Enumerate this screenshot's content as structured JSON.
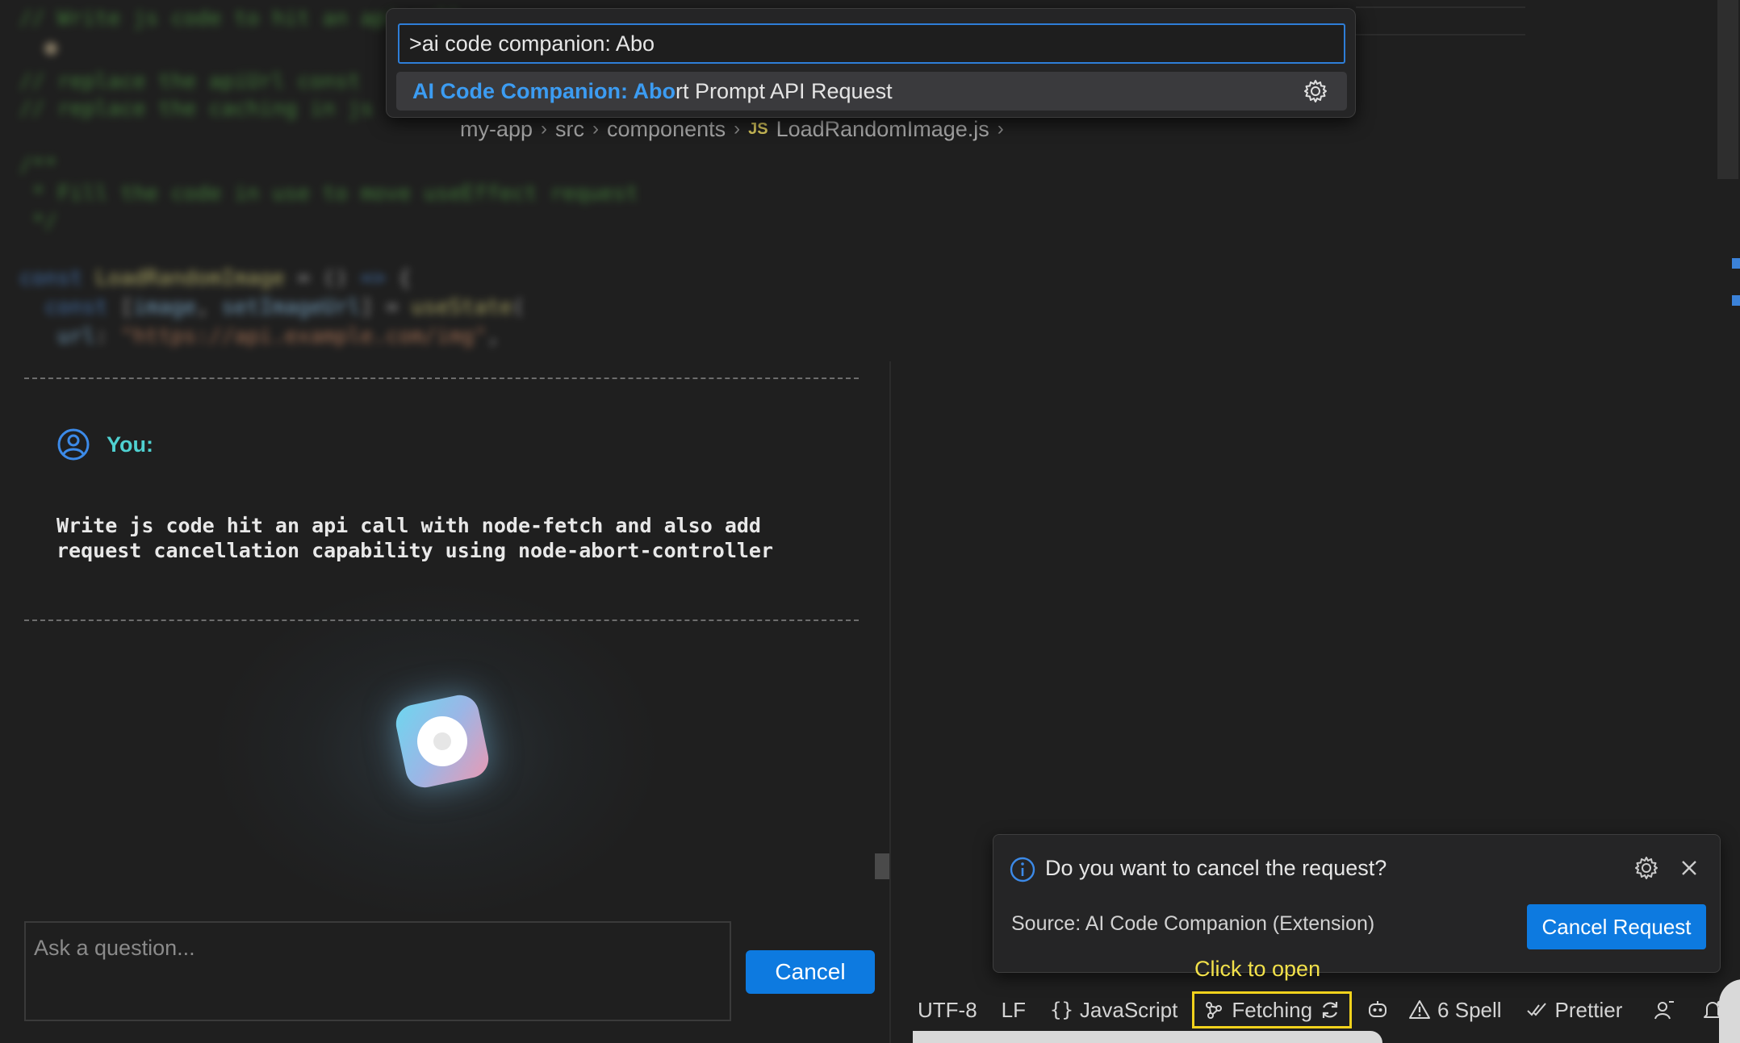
{
  "command_palette": {
    "query": ">ai code companion: Abo",
    "result": {
      "highlight": "AI Code Companion: Abo",
      "rest": "rt Prompt API Request",
      "action_icon": "gear-icon"
    }
  },
  "breadcrumb": {
    "items": [
      "my-app",
      "src",
      "components"
    ],
    "file_badge": "JS",
    "file": "LoadRandomImage.js"
  },
  "chat": {
    "user_label": "You:",
    "user_icon": "user-avatar-icon",
    "message": "Write js code hit an api call with node-fetch and also add\nrequest cancellation capability using node-abort-controller",
    "input_placeholder": "Ask a question...",
    "cancel_label": "Cancel"
  },
  "notification": {
    "icon": "info-icon",
    "message": "Do you want to cancel the request?",
    "source": "Source: AI Code Companion (Extension)",
    "button_label": "Cancel Request"
  },
  "hint": "Click to open",
  "statusbar": {
    "encoding": "UTF-8",
    "eol": "LF",
    "language": "JavaScript",
    "fetching": "Fetching",
    "spell": "6 Spell",
    "prettier": "Prettier"
  },
  "colors": {
    "accent": "#0d7ae0",
    "highlight_text": "#3c9cf2",
    "user_label": "#4fd1d1",
    "hint": "#f2e14a",
    "fetch_outline": "#f2d21c"
  }
}
